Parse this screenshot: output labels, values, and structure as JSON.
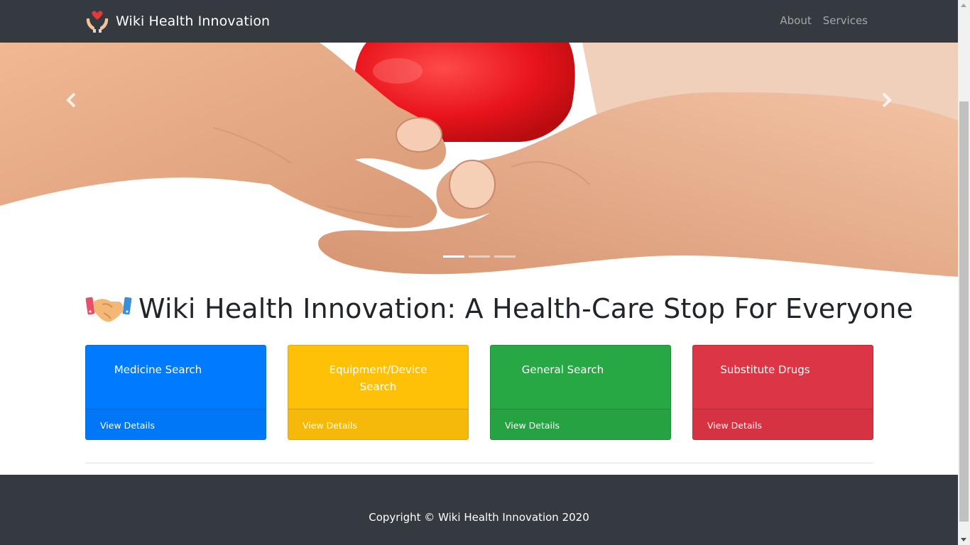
{
  "navbar": {
    "brand": "Wiki Health Innovation",
    "logo_icon": "heart-in-hands-icon",
    "links": [
      "About",
      "Services"
    ]
  },
  "carousel": {
    "image": "hands-holding-red-heart-photo",
    "prev_icon": "chevron-left-icon",
    "next_icon": "chevron-right-icon",
    "slide_count": 3,
    "active_slide": 1
  },
  "headline": {
    "icon": "handshake-icon",
    "text": "Wiki Health Innovation: A Health-Care Stop For Everyone"
  },
  "cards": [
    {
      "title": "Medicine Search",
      "link": "View Details",
      "color": "#007bff"
    },
    {
      "title": "Equipment/Device Search",
      "link": "View Details",
      "color": "#ffc107"
    },
    {
      "title": "General Search",
      "link": "View Details",
      "color": "#28a745"
    },
    {
      "title": "Substitute Drugs",
      "link": "View Details",
      "color": "#dc3545"
    }
  ],
  "footer": {
    "copyright": "Copyright © Wiki Health Innovation 2020"
  },
  "colors": {
    "navbar_bg": "#343a40",
    "footer_bg": "#343a40",
    "heading_text": "#212529"
  }
}
